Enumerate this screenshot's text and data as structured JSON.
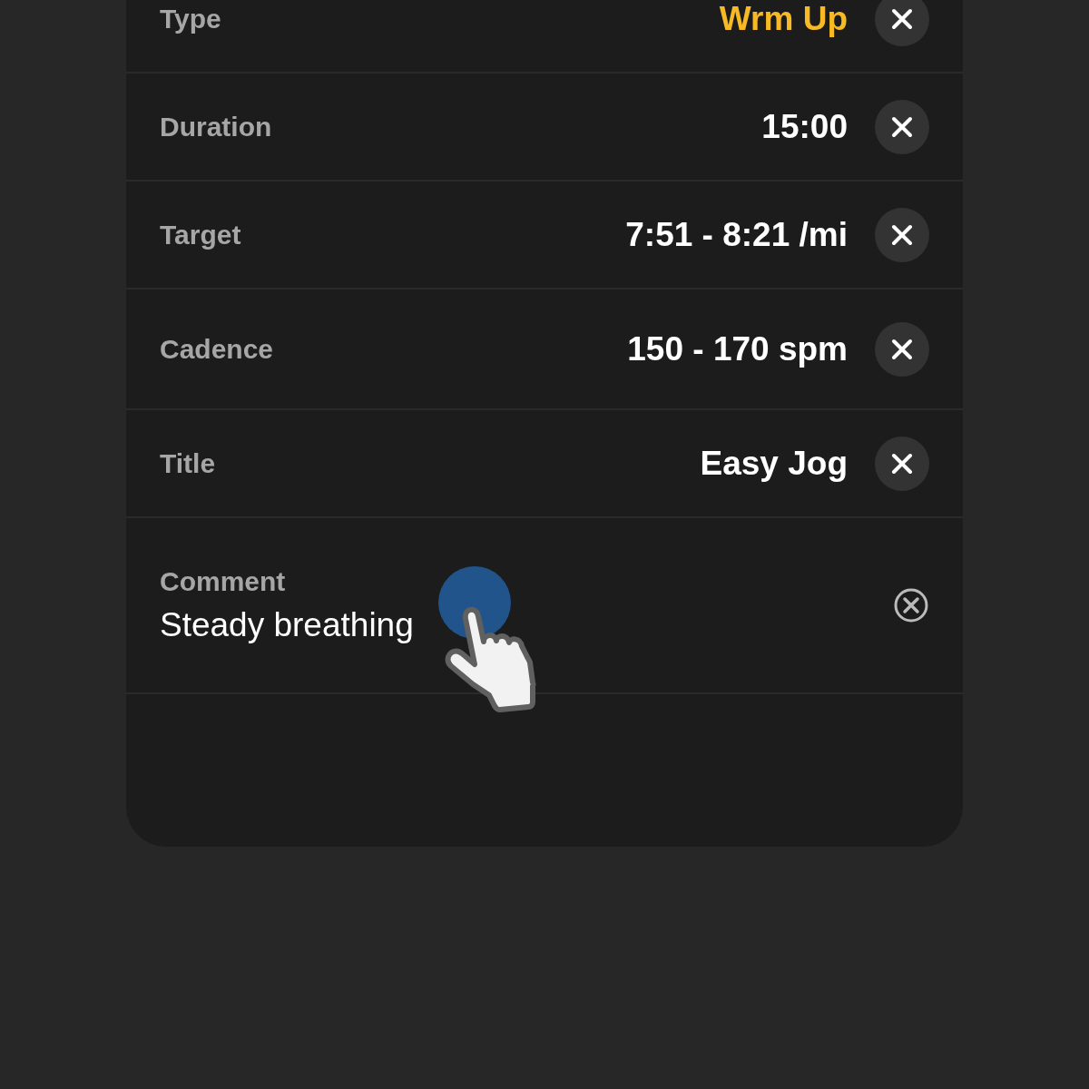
{
  "fields": [
    {
      "kind": "inline",
      "label": "Type",
      "value": "Wrm Up",
      "color": "#f7b924"
    },
    {
      "kind": "inline",
      "label": "Duration",
      "value": "15:00",
      "color": "#ffffff"
    },
    {
      "kind": "inline",
      "label": "Target",
      "value": "7:51 - 8:21 /mi",
      "color": "#ffffff"
    },
    {
      "kind": "inline",
      "label": "Cadence",
      "value": "150 - 170 spm",
      "color": "#ffffff"
    },
    {
      "kind": "inline",
      "label": "Title",
      "value": "Easy Jog",
      "color": "#ffffff"
    },
    {
      "kind": "stacked",
      "label": "Comment",
      "value": "Steady breathing",
      "color": "#ffffff"
    }
  ]
}
